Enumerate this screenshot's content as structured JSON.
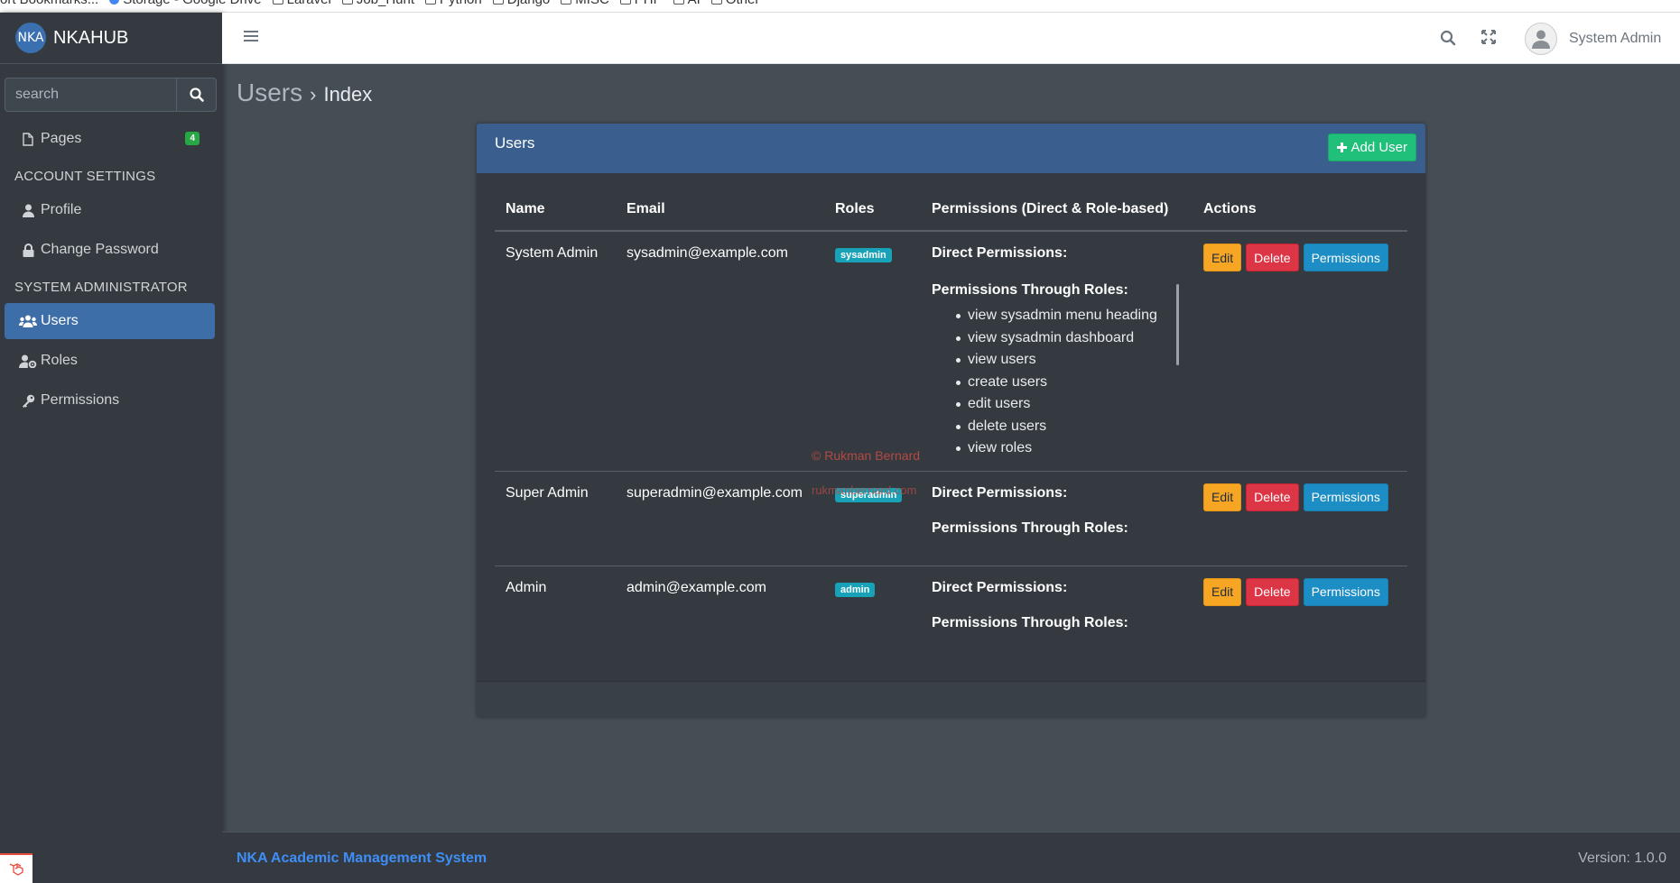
{
  "bookmarks": [
    "ort Bookmarks...",
    "Storage - Google Drive",
    "Laravel",
    "Job_Hunt",
    "Python",
    "Django",
    "MISC",
    "PHP",
    "AI",
    "Other"
  ],
  "brand": {
    "logo_text": "NKA",
    "name": "NKAHUB"
  },
  "sidebar": {
    "search_placeholder": "search",
    "pages_label": "Pages",
    "pages_badge": "4",
    "account_header": "ACCOUNT SETTINGS",
    "profile_label": "Profile",
    "change_password_label": "Change Password",
    "sysadmin_header": "SYSTEM ADMINISTRATOR",
    "users_label": "Users",
    "roles_label": "Roles",
    "permissions_label": "Permissions"
  },
  "topbar": {
    "username": "System Admin"
  },
  "breadcrumb": {
    "section": "Users",
    "separator": "›",
    "page": "Index"
  },
  "card": {
    "title": "Users",
    "add_button": "Add User"
  },
  "table": {
    "headers": [
      "Name",
      "Email",
      "Roles",
      "Permissions (Direct & Role-based)",
      "Actions"
    ],
    "direct_label": "Direct Permissions:",
    "through_label": "Permissions Through Roles:",
    "edit_label": "Edit",
    "delete_label": "Delete",
    "permissions_label": "Permissions",
    "rows": [
      {
        "name": "System Admin",
        "email": "sysadmin@example.com",
        "role": "sysadmin",
        "role_permissions": [
          "view sysadmin menu heading",
          "view sysadmin dashboard",
          "view users",
          "create users",
          "edit users",
          "delete users",
          "view roles"
        ]
      },
      {
        "name": "Super Admin",
        "email": "superadmin@example.com",
        "role": "superadmin",
        "role_permissions": []
      },
      {
        "name": "Admin",
        "email": "admin@example.com",
        "role": "admin",
        "role_permissions": []
      }
    ]
  },
  "watermark": {
    "line1": "© Rukman Bernard",
    "line2": "rukmanbernard.com"
  },
  "footer": {
    "system_name": "NKA Academic Management System",
    "version": "Version: 1.0.0"
  },
  "colors": {
    "sidebar_bg": "#343a40",
    "active_item": "#3e6ea8",
    "card_header": "#3a5f8f",
    "success": "#20c07a",
    "warning": "#f6a623",
    "danger": "#dc3545",
    "info": "#1d8ec5",
    "footer_link": "#3f8ef7"
  }
}
